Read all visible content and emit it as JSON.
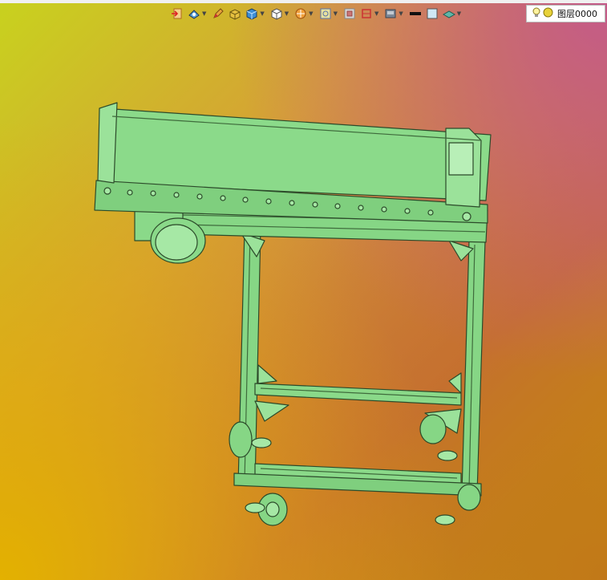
{
  "toolbar": {
    "buttons": [
      {
        "name": "exit-view-icon",
        "has_menu": false
      },
      {
        "name": "view-orientation-icon",
        "has_menu": true
      },
      {
        "name": "pencil-icon",
        "has_menu": false
      },
      {
        "name": "shaded-box-icon",
        "has_menu": false
      },
      {
        "name": "solid-cube-icon",
        "has_menu": true
      },
      {
        "name": "wireframe-cube-icon",
        "has_menu": true
      },
      {
        "name": "section-icon",
        "has_menu": true
      },
      {
        "name": "zoom-fit-icon",
        "has_menu": true
      },
      {
        "name": "grid-icon",
        "has_menu": false
      },
      {
        "name": "datum-plane-icon",
        "has_menu": true
      },
      {
        "name": "display-mode-icon",
        "has_menu": true
      },
      {
        "name": "line-color-icon",
        "has_menu": false
      },
      {
        "name": "fill-color-icon",
        "has_menu": false
      },
      {
        "name": "surface-icon",
        "has_menu": true
      }
    ],
    "colors": {
      "line_color": "#111111",
      "fill_color": "#cfe8f6"
    }
  },
  "layer": {
    "label": "图层0000",
    "icons": [
      "lightbulb-icon",
      "layer-status-icon"
    ]
  },
  "model": {
    "description_color": "#7ed37c",
    "outline_color": "#2c4a2a"
  }
}
